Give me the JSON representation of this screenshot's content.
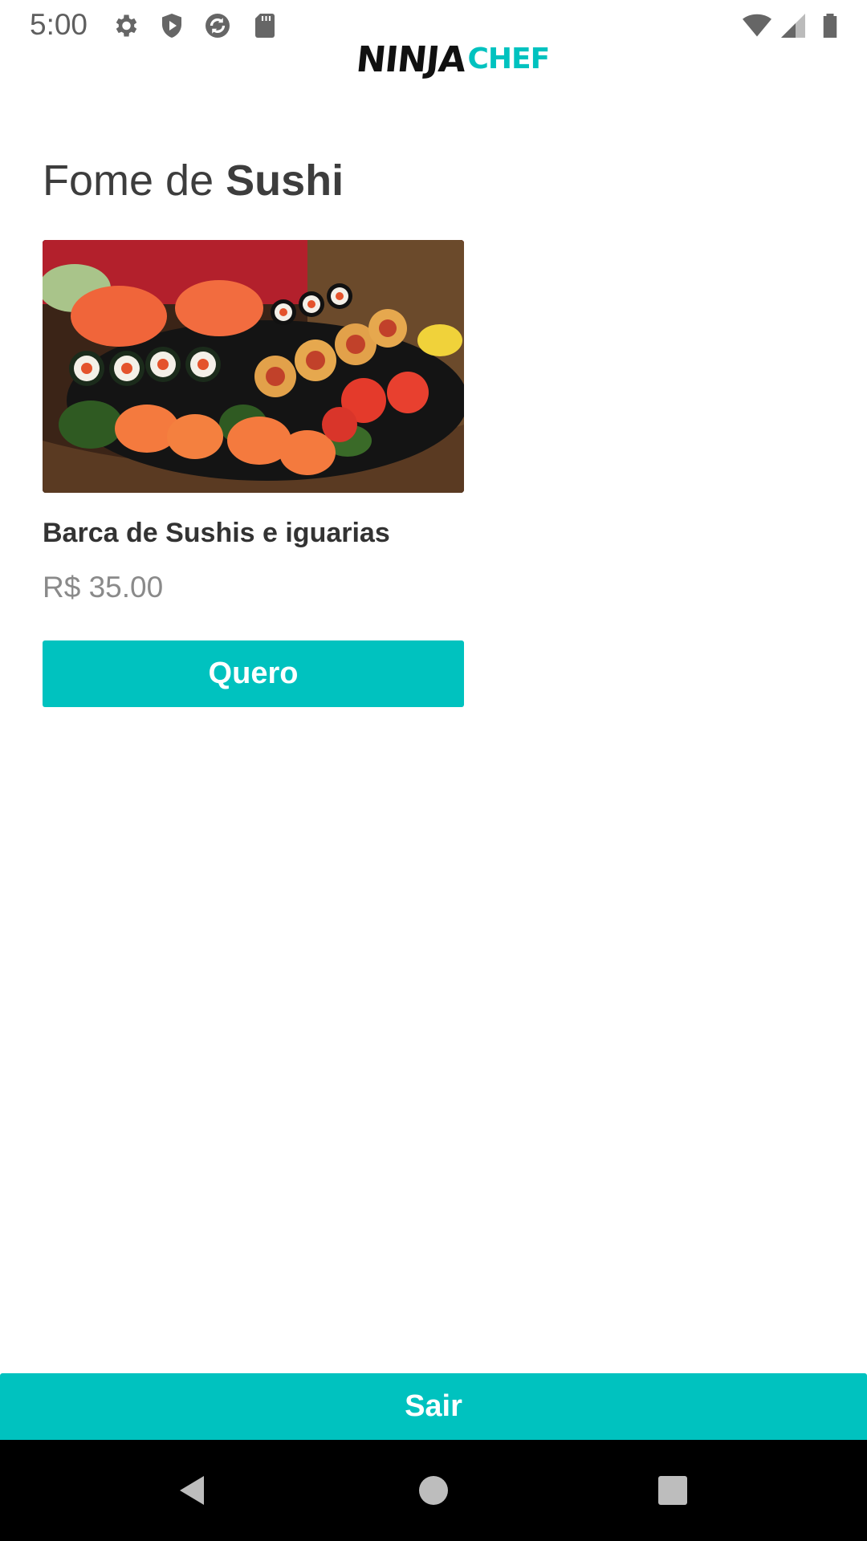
{
  "status_bar": {
    "time": "5:00",
    "icons": [
      "gear-icon",
      "shield-play-icon",
      "sync-icon",
      "sd-card-icon"
    ],
    "right_icons": [
      "wifi-icon",
      "cell-signal-icon",
      "battery-icon"
    ]
  },
  "app": {
    "logo_left": "NINJA",
    "logo_right": "CHEF",
    "brand_color": "#00c2bf"
  },
  "page": {
    "title_light": "Fome de ",
    "title_bold": "Sushi"
  },
  "product": {
    "image_icon": "sushi-platter-image",
    "name": "Barca de Sushis e iguarias",
    "price": "R$ 35.00",
    "button_label": "Quero"
  },
  "footer": {
    "exit_label": "Sair"
  },
  "nav": {
    "icons": [
      "back-icon",
      "home-icon",
      "recents-icon"
    ]
  }
}
